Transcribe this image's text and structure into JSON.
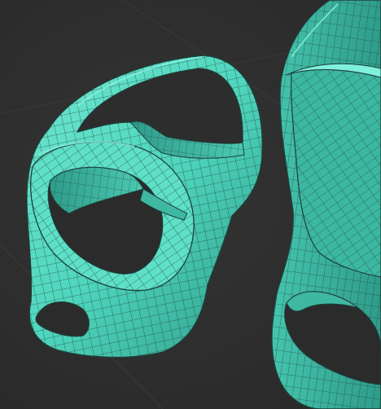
{
  "viewport": {
    "background_color": "#2e2e2e",
    "grid_color": "#3a3a3a",
    "mesh_fill_color": "#4fd6bd",
    "mesh_shadow_color": "#2f9c8a",
    "mesh_highlight_color": "#7ff0dc",
    "wire_color": "#1e3f3a"
  }
}
